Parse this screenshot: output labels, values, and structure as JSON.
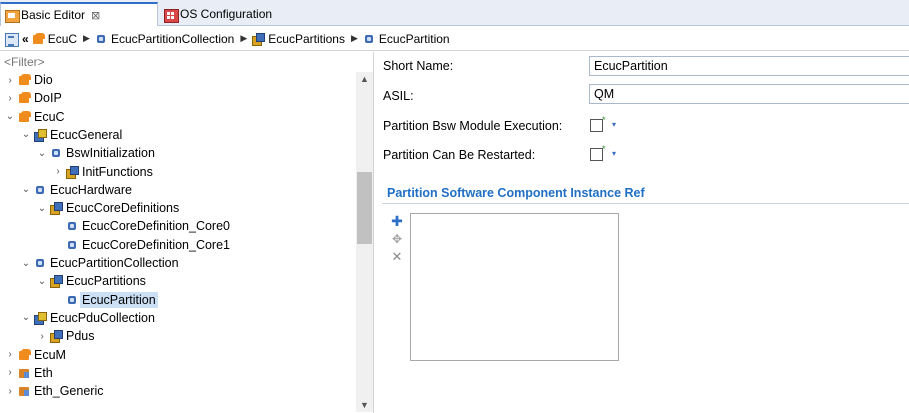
{
  "tabs": [
    {
      "label": "Basic Editor",
      "close": "⊠",
      "icon": "basic-editor-icon"
    },
    {
      "label": "OS Configuration",
      "icon": "os-config-icon"
    }
  ],
  "breadcrumb": {
    "back_glyph": "«",
    "items": [
      "EcuC",
      "EcucPartitionCollection",
      "EcucPartitions",
      "EcucPartition"
    ],
    "sep": "▶"
  },
  "tree": {
    "filter_placeholder": "<Filter>",
    "items": [
      {
        "label": "Dio",
        "toggle": "›",
        "icon": "module"
      },
      {
        "label": "DoIP",
        "toggle": "›",
        "icon": "module"
      },
      {
        "label": "EcuC",
        "toggle": "⌄",
        "icon": "module"
      },
      {
        "label": "EcucGeneral",
        "toggle": "⌄",
        "icon": "pdu"
      },
      {
        "label": "BswInitialization",
        "toggle": "⌄",
        "icon": "container"
      },
      {
        "label": "InitFunctions",
        "toggle": "›",
        "icon": "multi"
      },
      {
        "label": "EcucHardware",
        "toggle": "⌄",
        "icon": "container"
      },
      {
        "label": "EcucCoreDefinitions",
        "toggle": "⌄",
        "icon": "multi"
      },
      {
        "label": "EcucCoreDefinition_Core0",
        "toggle": "",
        "icon": "container"
      },
      {
        "label": "EcucCoreDefinition_Core1",
        "toggle": "",
        "icon": "container"
      },
      {
        "label": "EcucPartitionCollection",
        "toggle": "⌄",
        "icon": "container"
      },
      {
        "label": "EcucPartitions",
        "toggle": "⌄",
        "icon": "multi"
      },
      {
        "label": "EcucPartition",
        "toggle": "",
        "icon": "container",
        "selected": true
      },
      {
        "label": "EcucPduCollection",
        "toggle": "⌄",
        "icon": "pdu"
      },
      {
        "label": "Pdus",
        "toggle": "›",
        "icon": "multi"
      },
      {
        "label": "EcuM",
        "toggle": "›",
        "icon": "module"
      },
      {
        "label": "Eth",
        "toggle": "›",
        "icon": "module-alt"
      },
      {
        "label": "Eth_Generic",
        "toggle": "›",
        "icon": "module-alt"
      }
    ]
  },
  "form": {
    "short_name_label": "Short Name:",
    "short_name_value": "EcucPartition",
    "asil_label": "ASIL:",
    "asil_value": "QM",
    "bsw_exec_label": "Partition Bsw Module Execution:",
    "restart_label": "Partition Can Be Restarted:",
    "section_title": "Partition Software Component Instance Ref",
    "checkbox_star": "*",
    "checkbox_dropdown": "▾"
  },
  "toolbar": {
    "add_glyph": "✚",
    "add_multi_glyph": "✥",
    "delete_glyph": "✕"
  },
  "scrollbar": {
    "up": "▲",
    "down": "▼"
  }
}
